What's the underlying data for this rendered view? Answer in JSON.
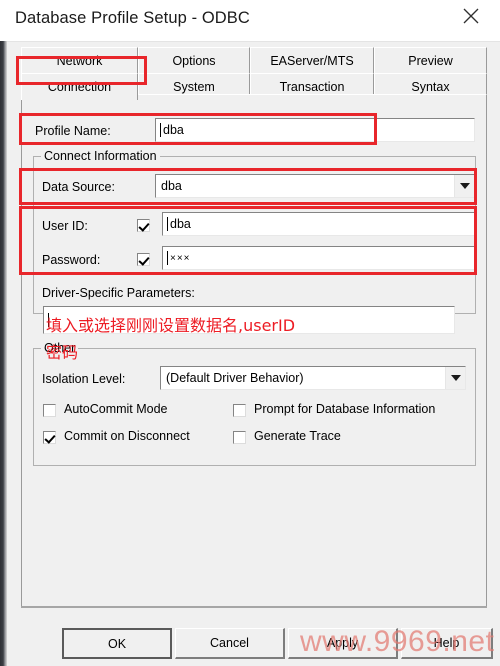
{
  "window": {
    "title": "Database Profile Setup - ODBC",
    "close_icon": "close-icon"
  },
  "tabs": {
    "row1": [
      {
        "label": "Network",
        "selected": false
      },
      {
        "label": "Options",
        "selected": false
      },
      {
        "label": "EAServer/MTS",
        "selected": false
      },
      {
        "label": "Preview",
        "selected": false
      }
    ],
    "row2": [
      {
        "label": "Connection",
        "selected": true
      },
      {
        "label": "System",
        "selected": false
      },
      {
        "label": "Transaction",
        "selected": false
      },
      {
        "label": "Syntax",
        "selected": false
      }
    ]
  },
  "form": {
    "profile_name": {
      "label": "Profile Name:",
      "value": "dba"
    },
    "connect_information": {
      "title": "Connect Information"
    },
    "data_source": {
      "label": "Data Source:",
      "value": "dba",
      "arrow_icon": "chevron-down-icon"
    },
    "user_id": {
      "label": "User ID:",
      "value": "dba",
      "checked": true
    },
    "password": {
      "label": "Password:",
      "value": "×××",
      "checked": true
    },
    "driver_params": {
      "label": "Driver-Specific Parameters:",
      "value": ""
    },
    "other": {
      "title": "Other"
    },
    "isolation_level": {
      "label": "Isolation Level:",
      "value": "(Default Driver Behavior)",
      "arrow_icon": "chevron-down-icon"
    },
    "checkboxes": [
      {
        "label": "AutoCommit Mode",
        "checked": false
      },
      {
        "label": "Prompt for Database Information",
        "checked": false
      },
      {
        "label": "Commit on Disconnect",
        "checked": true
      },
      {
        "label": "Generate Trace",
        "checked": false
      }
    ]
  },
  "annotations": {
    "color": "#e8262b",
    "text_color": "#ed1c24",
    "note_line1": "填入或选择刚刚设置数据名,userID",
    "note_line2": "密码"
  },
  "buttons": {
    "ok": "OK",
    "cancel": "Cancel",
    "apply": "Apply",
    "help": "Help"
  },
  "watermark": {
    "text": "www.9969.net"
  }
}
